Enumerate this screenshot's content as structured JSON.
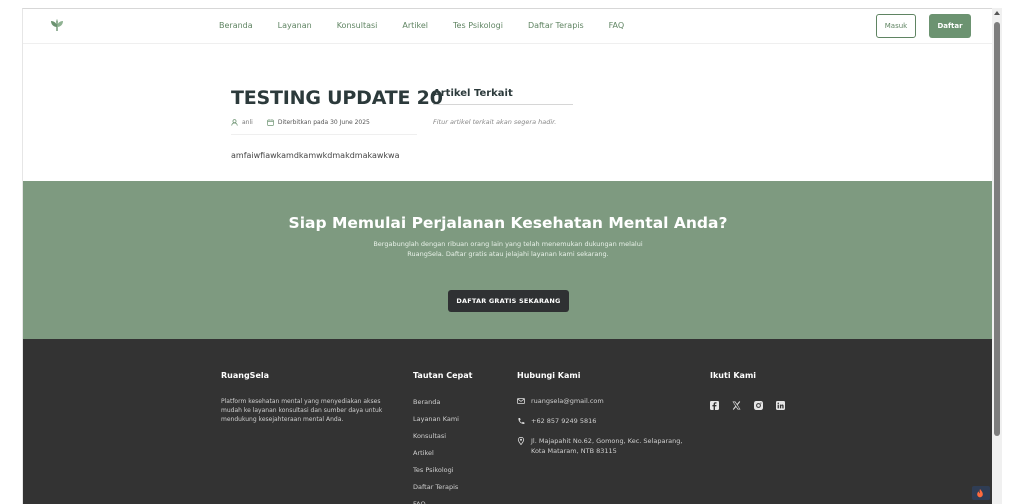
{
  "navbar": {
    "links": [
      "Beranda",
      "Layanan",
      "Konsultasi",
      "Artikel",
      "Tes Psikologi",
      "Daftar Terapis",
      "FAQ"
    ],
    "login_label": "Masuk",
    "register_label": "Daftar"
  },
  "article": {
    "title": "TESTING UPDATE 20",
    "author": "anli",
    "published": "Diterbitkan pada 30 June 2025",
    "body": "amfaiwfiawkamdkamwkdmakdmakawkwa"
  },
  "related": {
    "title": "Artikel Terkait",
    "note": "Fitur artikel terkait akan segera hadir."
  },
  "cta": {
    "title": "Siap Memulai Perjalanan Kesehatan Mental Anda?",
    "description": "Bergabunglah dengan ribuan orang lain yang telah menemukan dukungan melalui RuangSela. Daftar gratis atau jelajahi layanan kami sekarang.",
    "button_label": "DAFTAR GRATIS SEKARANG"
  },
  "footer": {
    "brand": "RuangSela",
    "about": "Platform kesehatan mental yang menyediakan akses mudah ke layanan konsultasi dan sumber daya untuk mendukung kesejahteraan mental Anda.",
    "quick_links_title": "Tautan Cepat",
    "quick_links": [
      "Beranda",
      "Layanan Kami",
      "Konsultasi",
      "Artikel",
      "Tes Psikologi",
      "Daftar Terapis",
      "FAQ"
    ],
    "contact_title": "Hubungi Kami",
    "email": "ruangsela@gmail.com",
    "phone": "+62 857 9249 5816",
    "address": "Jl. Majapahit No.62, Gomong, Kec. Selaparang, Kota Mataram, NTB 83115",
    "follow_title": "Ikuti Kami",
    "socials": [
      "facebook-icon",
      "x-icon",
      "instagram-icon",
      "linkedin-icon"
    ]
  },
  "colors": {
    "brand_green": "#6c9371",
    "cta_background": "#7e9a80",
    "footer_background": "#333333"
  }
}
